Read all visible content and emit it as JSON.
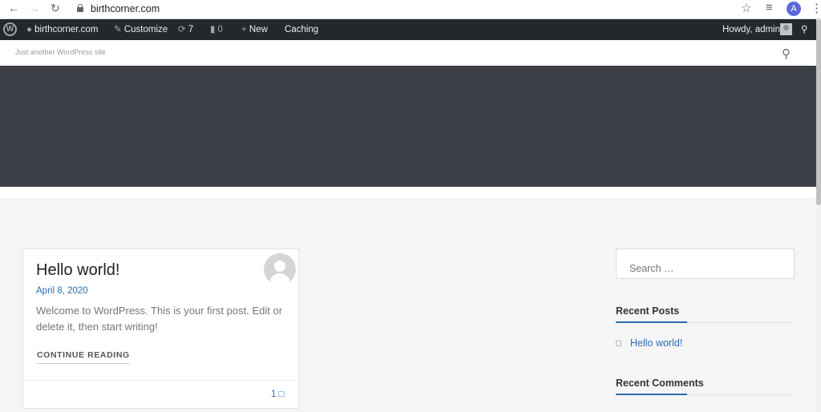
{
  "browser": {
    "url": "birthcorner.com",
    "profile_initial": "A",
    "back_icon": "←",
    "forward_icon": "→",
    "reload_icon": "↻",
    "star_icon": "☆",
    "media_icon": "≡",
    "menu_icon": "⋮"
  },
  "admin_bar": {
    "site_name": "birthcorner.com",
    "customize": "Customize",
    "updates_count": "7",
    "comments_count": "0",
    "new_label": "New",
    "caching_label": "Caching",
    "greeting": "Howdy, admin"
  },
  "site": {
    "tagline": "Just another WordPress site"
  },
  "post": {
    "title": "Hello world!",
    "date": "April 8, 2020",
    "excerpt": "Welcome to WordPress. This is your first post. Edit or delete it, then start writing!",
    "continue_label": "CONTINUE READING",
    "comments": "1 □"
  },
  "sidebar": {
    "search_placeholder": "Search …",
    "recent_posts_title": "Recent Posts",
    "recent_posts": [
      {
        "label": "Hello world!"
      }
    ],
    "recent_comments_title": "Recent Comments"
  },
  "colors": {
    "admin_bar": "#23282d",
    "hero": "#3c3f46",
    "link": "#2b6cb0"
  }
}
